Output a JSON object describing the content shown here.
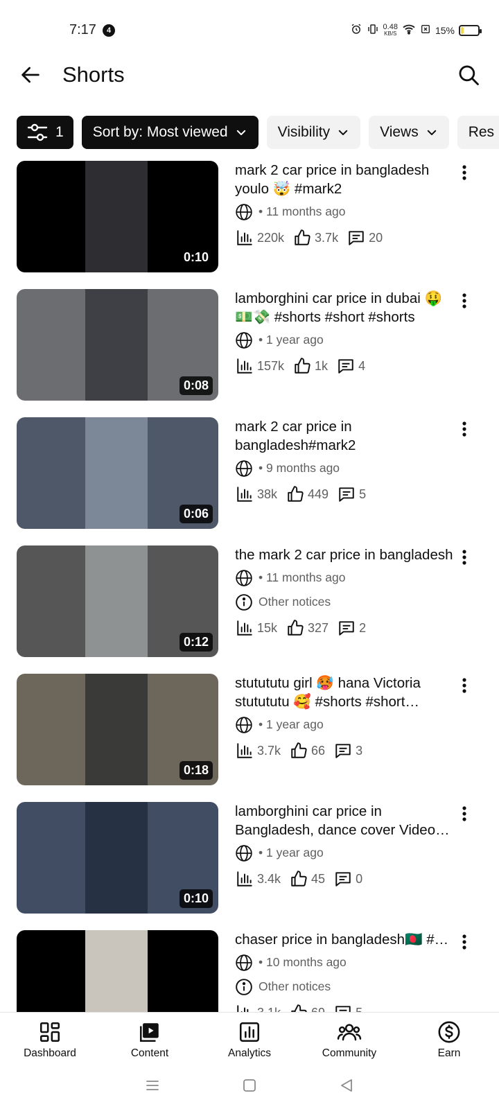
{
  "status_bar": {
    "time": "7:17",
    "notification_count": "4",
    "net_speed": "0.48",
    "net_unit": "KB/S",
    "battery": "15%",
    "battery_level": 0.15
  },
  "app_bar": {
    "title": "Shorts"
  },
  "filters": {
    "filter_count": "1",
    "sort_label": "Sort by: Most viewed",
    "visibility_label": "Visibility",
    "views_label": "Views",
    "restrictions_label": "Res"
  },
  "videos": [
    {
      "title": "mark 2 car price in bangladesh youlo 🤯 #mark2",
      "time_ago": "• 11 months ago",
      "notice": "",
      "views": "220k",
      "likes": "3.7k",
      "comments": "20",
      "duration": "0:10",
      "colors": {
        "bg": "#000000",
        "center": "#2e2d32"
      }
    },
    {
      "title": "lamborghini car price in dubai 🤑💵💸 #shorts #short #shorts",
      "time_ago": "• 1 year ago",
      "notice": "",
      "views": "157k",
      "likes": "1k",
      "comments": "4",
      "duration": "0:08",
      "colors": {
        "bg": "#6b6d70",
        "center": "#3f4046"
      }
    },
    {
      "title": "mark 2 car price in bangladesh#mark2",
      "time_ago": "• 9 months ago",
      "notice": "",
      "views": "38k",
      "likes": "449",
      "comments": "5",
      "duration": "0:06",
      "colors": {
        "bg": "#4e5868",
        "center": "#7c8797"
      }
    },
    {
      "title": "the mark 2 car price  in bangladesh",
      "time_ago": "• 11 months ago",
      "notice": "Other notices",
      "views": "15k",
      "likes": "327",
      "comments": "2",
      "duration": "0:12",
      "colors": {
        "bg": "#565656",
        "center": "#8f9292"
      }
    },
    {
      "title": "stutututu girl 🥵 hana Victoria stutututu 🥰 #shorts #short #shorts",
      "time_ago": "• 1 year ago",
      "notice": "",
      "views": "3.7k",
      "likes": "66",
      "comments": "3",
      "duration": "0:18",
      "colors": {
        "bg": "#6d675b",
        "center": "#3a3a38"
      }
    },
    {
      "title": "lamborghini car price in Bangladesh, dance cover Video song",
      "time_ago": "• 1 year ago",
      "notice": "",
      "views": "3.4k",
      "likes": "45",
      "comments": "0",
      "duration": "0:10",
      "colors": {
        "bg": "#414d63",
        "center": "#273144"
      }
    },
    {
      "title": "chaser price in bangladesh🇧🇩 #shorts",
      "time_ago": "• 10 months ago",
      "notice": "Other notices",
      "views": "3.1k",
      "likes": "69",
      "comments": "5",
      "duration": "",
      "colors": {
        "bg": "#000000",
        "center": "#c9c5bd"
      }
    }
  ],
  "bottom_nav": [
    {
      "label": "Dashboard",
      "icon": "dashboard-icon"
    },
    {
      "label": "Content",
      "icon": "content-icon"
    },
    {
      "label": "Analytics",
      "icon": "analytics-icon"
    },
    {
      "label": "Community",
      "icon": "community-icon"
    },
    {
      "label": "Earn",
      "icon": "earn-icon"
    }
  ]
}
